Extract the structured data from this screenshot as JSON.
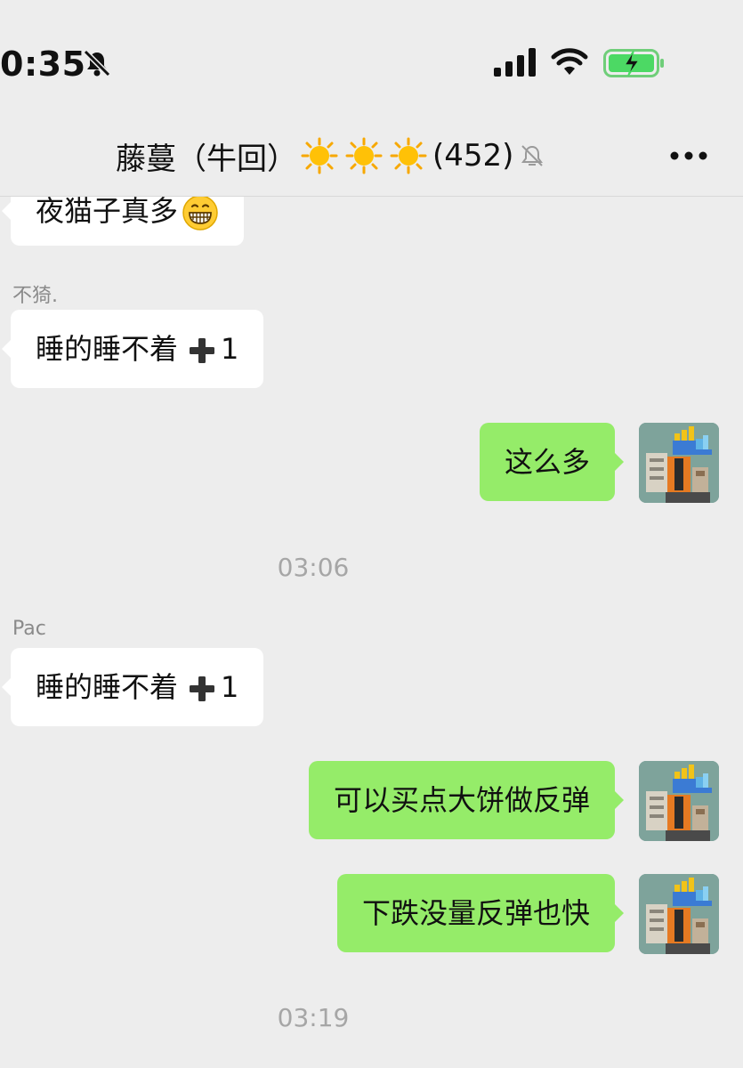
{
  "status_bar": {
    "time": "0:35",
    "icons": [
      "bell-slash-icon",
      "cellular-signal-icon",
      "wifi-icon",
      "battery-charging-icon"
    ]
  },
  "nav": {
    "title": "藤蔓（牛回）",
    "title_emoji": [
      "sun-emoji",
      "sun-emoji",
      "sun-emoji"
    ],
    "member_count": "(452)",
    "icons": [
      "bell-slash-icon",
      "more-icon"
    ]
  },
  "messages": [
    {
      "direction": "in",
      "text": "夜猫子真多",
      "emoji": "grinning-face-emoji"
    },
    {
      "direction": "in",
      "sender": "不猗.",
      "text": "睡的睡不着",
      "suffix": "1",
      "suffix_icon": "heavy-plus-icon"
    },
    {
      "direction": "out",
      "text": "这么多",
      "avatar": "user-avatar"
    },
    {
      "type": "timestamp",
      "text": "03:06"
    },
    {
      "direction": "in",
      "sender": "Pac",
      "text": "睡的睡不着",
      "suffix": "1",
      "suffix_icon": "heavy-plus-icon"
    },
    {
      "direction": "out",
      "text": "可以买点大饼做反弹",
      "avatar": "user-avatar"
    },
    {
      "direction": "out",
      "text": "下跌没量反弹也快",
      "avatar": "user-avatar"
    },
    {
      "type": "timestamp",
      "text": "03:19"
    }
  ],
  "colors": {
    "background": "#ededed",
    "incoming_bubble": "#ffffff",
    "outgoing_bubble": "#95ec69",
    "secondary_text": "#8a8a8a",
    "battery_fill": "#4cd964"
  }
}
